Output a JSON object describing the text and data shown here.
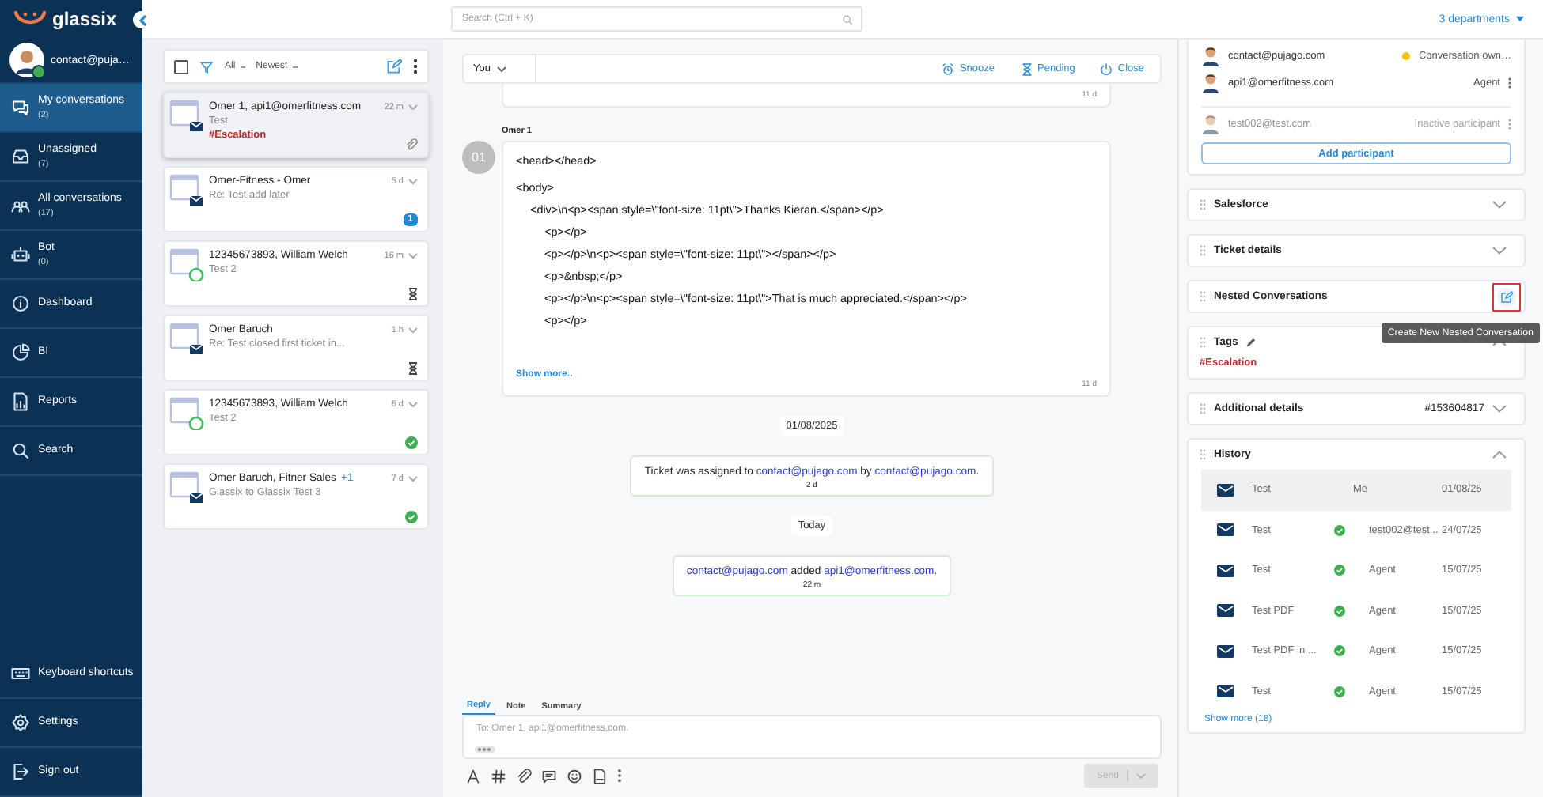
{
  "sidebar": {
    "logo": "glassix",
    "user": {
      "name": "contact@puja…",
      "online": true
    },
    "nav": [
      {
        "label": "My conversations",
        "count": "(2)",
        "selected": true
      },
      {
        "label": "Unassigned",
        "count": "(7)",
        "selected": false
      },
      {
        "label": "All conversations",
        "count": "(17)",
        "selected": false
      },
      {
        "label": "Bot",
        "count": "(0)",
        "selected": false
      },
      {
        "label": "Dashboard",
        "selected": false
      },
      {
        "label": "BI",
        "selected": false
      },
      {
        "label": "Reports",
        "selected": false
      },
      {
        "label": "Search",
        "selected": false
      }
    ],
    "bottom_nav": [
      {
        "label": "Keyboard shortcuts"
      },
      {
        "label": "Settings"
      },
      {
        "label": "Sign out"
      }
    ]
  },
  "list_toolbar": {
    "select_all": {
      "checked": false
    },
    "filter": "All",
    "sort": "Newest"
  },
  "conversations": [
    {
      "title": "Omer 1, api1@omerfitness.com",
      "time": "22 m",
      "channel": {
        "kind": "email"
      },
      "subject": "Test",
      "tag": "#Escalation",
      "status": {
        "kind": "attachment"
      },
      "selected": true
    },
    {
      "title": "Omer-Fitness - Omer",
      "time": "5 d",
      "channel": {
        "kind": "email"
      },
      "subject": "Re: Test add later",
      "status": {
        "kind": "unread",
        "count": "1"
      },
      "selected": false
    },
    {
      "title": "12345673893, William Welch",
      "time": "16 m",
      "channel": {
        "kind": "whatsapp"
      },
      "subject": "Test 2",
      "status": {
        "kind": "pending"
      },
      "selected": false
    },
    {
      "title": "Omer Baruch",
      "time": "1 h",
      "channel": {
        "kind": "email"
      },
      "subject": "Re: Test closed first ticket in...",
      "status": {
        "kind": "pending"
      },
      "selected": false
    },
    {
      "title": "12345673893, William Welch",
      "time": "6 d",
      "channel": {
        "kind": "whatsapp"
      },
      "subject": "Test 2",
      "status": {
        "kind": "closed"
      },
      "selected": false
    },
    {
      "title": "Omer Baruch, Fitner Sales",
      "extra": "+1",
      "time": "7 d",
      "channel": {
        "kind": "email"
      },
      "subject": "Glassix to Glassix Test 3",
      "status": {
        "kind": "closed"
      },
      "selected": false
    }
  ],
  "search": {
    "placeholder": "Search (Ctrl + K)"
  },
  "departments": "3 departments",
  "action_bar": {
    "assignee": "You",
    "actions": [
      "Snooze",
      "Pending",
      "Close"
    ]
  },
  "thread": [
    {
      "kind": "message",
      "time": "11 d"
    },
    {
      "kind": "message",
      "sender": "Omer 1",
      "initials": "01",
      "blocks": [
        {
          "text": "<head></head>"
        },
        {
          "text": "<body>",
          "children": [
            {
              "text": "<div>\\n<p><span style=\\\"font-size: 11pt\\\">Thanks Kieran.</span></p>",
              "children": [
                {
                  "text": "<p></p>"
                },
                {
                  "text": "<p></p>\\n<p><span style=\\\"font-size: 11pt\\\"></span></p>"
                },
                {
                  "text": "<p>&nbsp;</p>"
                },
                {
                  "text": "<p></p>\\n<p><span style=\\\"font-size: 11pt\\\">That is much appreciated.</span></p>"
                },
                {
                  "text": "<p></p>"
                }
              ]
            }
          ]
        }
      ],
      "show_more": "Show more..",
      "time": "11 d"
    },
    {
      "kind": "date",
      "text": "01/08/2025"
    },
    {
      "kind": "event",
      "parts": [
        {
          "text": "Ticket was assigned to "
        },
        {
          "link": "contact@pujago.com"
        },
        {
          "text": " by "
        },
        {
          "link": "contact@pujago.com"
        },
        {
          "text": "."
        }
      ],
      "time": "2 d"
    },
    {
      "kind": "date",
      "text": "Today"
    },
    {
      "kind": "event",
      "parts": [
        {
          "link": "contact@pujago.com"
        },
        {
          "text": " added "
        },
        {
          "link": "api1@omerfitness.com"
        },
        {
          "text": "."
        }
      ],
      "time": "22 m"
    }
  ],
  "composer": {
    "tabs": [
      {
        "label": "Reply",
        "selected": true
      },
      {
        "label": "Note",
        "selected": false
      },
      {
        "label": "Summary",
        "selected": false
      }
    ],
    "placeholder": "To: Omer 1, api1@omerfitness.com.",
    "send": {
      "label": "Send",
      "disabled": true
    }
  },
  "participants": [
    {
      "email": "contact@pujago.com",
      "role": "Conversation own…",
      "owner": true,
      "inactive": false
    },
    {
      "email": "api1@omerfitness.com",
      "role": "Agent",
      "owner": false,
      "inactive": false
    },
    {
      "email": "test002@test.com",
      "role": "Inactive participant",
      "owner": false,
      "inactive": true
    }
  ],
  "add_participant": "Add participant",
  "sections": [
    {
      "kind": "plain",
      "title": "Salesforce",
      "expanded": false
    },
    {
      "kind": "plain",
      "title": "Ticket details",
      "expanded": false
    },
    {
      "kind": "nested",
      "title": "Nested Conversations",
      "highlighted": true,
      "tooltip": "Create New Nested Conversation"
    },
    {
      "kind": "tags",
      "title": "Tags",
      "expanded": true,
      "tags": [
        "#Escalation"
      ]
    },
    {
      "kind": "plain",
      "title": "Additional details",
      "value": "#153604817",
      "expanded": false
    },
    {
      "kind": "history",
      "title": "History",
      "expanded": true,
      "rows": [
        {
          "subject": "Test",
          "agent": "Me",
          "date": "01/08/25",
          "resolved": false,
          "selected": true
        },
        {
          "subject": "Test",
          "agent": "test002@test...",
          "date": "24/07/25",
          "resolved": true,
          "selected": false
        },
        {
          "subject": "Test",
          "agent": "Agent",
          "date": "15/07/25",
          "resolved": true,
          "selected": false
        },
        {
          "subject": "Test PDF",
          "agent": "Agent",
          "date": "15/07/25",
          "resolved": true,
          "selected": false
        },
        {
          "subject": "Test PDF in ...",
          "agent": "Agent",
          "date": "15/07/25",
          "resolved": true,
          "selected": false
        },
        {
          "subject": "Test",
          "agent": "Agent",
          "date": "15/07/25",
          "resolved": true,
          "selected": false
        }
      ],
      "show_more": "Show more (18)"
    }
  ]
}
